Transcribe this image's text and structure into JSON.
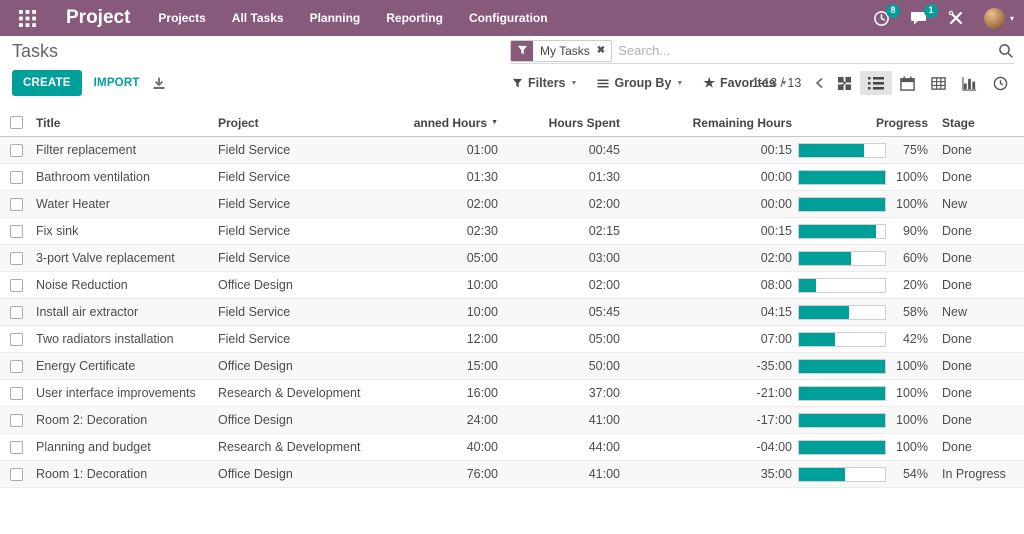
{
  "topbar": {
    "app_title": "Project",
    "menus": [
      "Projects",
      "All Tasks",
      "Planning",
      "Reporting",
      "Configuration"
    ],
    "activity_badge": "8",
    "messages_badge": "1"
  },
  "header": {
    "page_title": "Tasks"
  },
  "search": {
    "facet_label": "My Tasks",
    "placeholder": "Search..."
  },
  "controls": {
    "create_label": "CREATE",
    "import_label": "IMPORT",
    "filters_label": "Filters",
    "groupby_label": "Group By",
    "favorites_label": "Favorites",
    "pager_text": "1-13 / 13"
  },
  "colors": {
    "brand_purple": "#875A7B",
    "accent_teal": "#00A09A"
  },
  "table": {
    "columns": [
      "Title",
      "Project",
      "Planned Hours",
      "Hours Spent",
      "Remaining Hours",
      "Progress",
      "Stage"
    ],
    "sorted_by": "Planned Hours",
    "rows": [
      {
        "title": "Filter replacement",
        "project": "Field Service",
        "planned": "01:00",
        "spent": "00:45",
        "remaining": "00:15",
        "progress": 75,
        "progress_label": "75%",
        "stage": "Done"
      },
      {
        "title": "Bathroom ventilation",
        "project": "Field Service",
        "planned": "01:30",
        "spent": "01:30",
        "remaining": "00:00",
        "progress": 100,
        "progress_label": "100%",
        "stage": "Done"
      },
      {
        "title": "Water Heater",
        "project": "Field Service",
        "planned": "02:00",
        "spent": "02:00",
        "remaining": "00:00",
        "progress": 100,
        "progress_label": "100%",
        "stage": "New"
      },
      {
        "title": "Fix sink",
        "project": "Field Service",
        "planned": "02:30",
        "spent": "02:15",
        "remaining": "00:15",
        "progress": 90,
        "progress_label": "90%",
        "stage": "Done"
      },
      {
        "title": "3-port Valve replacement",
        "project": "Field Service",
        "planned": "05:00",
        "spent": "03:00",
        "remaining": "02:00",
        "progress": 60,
        "progress_label": "60%",
        "stage": "Done"
      },
      {
        "title": "Noise Reduction",
        "project": "Office Design",
        "planned": "10:00",
        "spent": "02:00",
        "remaining": "08:00",
        "progress": 20,
        "progress_label": "20%",
        "stage": "Done"
      },
      {
        "title": "Install air extractor",
        "project": "Field Service",
        "planned": "10:00",
        "spent": "05:45",
        "remaining": "04:15",
        "progress": 58,
        "progress_label": "58%",
        "stage": "New"
      },
      {
        "title": "Two radiators installation",
        "project": "Field Service",
        "planned": "12:00",
        "spent": "05:00",
        "remaining": "07:00",
        "progress": 42,
        "progress_label": "42%",
        "stage": "Done"
      },
      {
        "title": "Energy Certificate",
        "project": "Office Design",
        "planned": "15:00",
        "spent": "50:00",
        "remaining": "-35:00",
        "progress": 100,
        "progress_label": "100%",
        "stage": "Done"
      },
      {
        "title": "User interface improvements",
        "project": "Research & Development",
        "planned": "16:00",
        "spent": "37:00",
        "remaining": "-21:00",
        "progress": 100,
        "progress_label": "100%",
        "stage": "Done"
      },
      {
        "title": "Room 2: Decoration",
        "project": "Office Design",
        "planned": "24:00",
        "spent": "41:00",
        "remaining": "-17:00",
        "progress": 100,
        "progress_label": "100%",
        "stage": "Done"
      },
      {
        "title": "Planning and budget",
        "project": "Research & Development",
        "planned": "40:00",
        "spent": "44:00",
        "remaining": "-04:00",
        "progress": 100,
        "progress_label": "100%",
        "stage": "Done"
      },
      {
        "title": "Room 1: Decoration",
        "project": "Office Design",
        "planned": "76:00",
        "spent": "41:00",
        "remaining": "35:00",
        "progress": 54,
        "progress_label": "54%",
        "stage": "In Progress"
      }
    ]
  }
}
